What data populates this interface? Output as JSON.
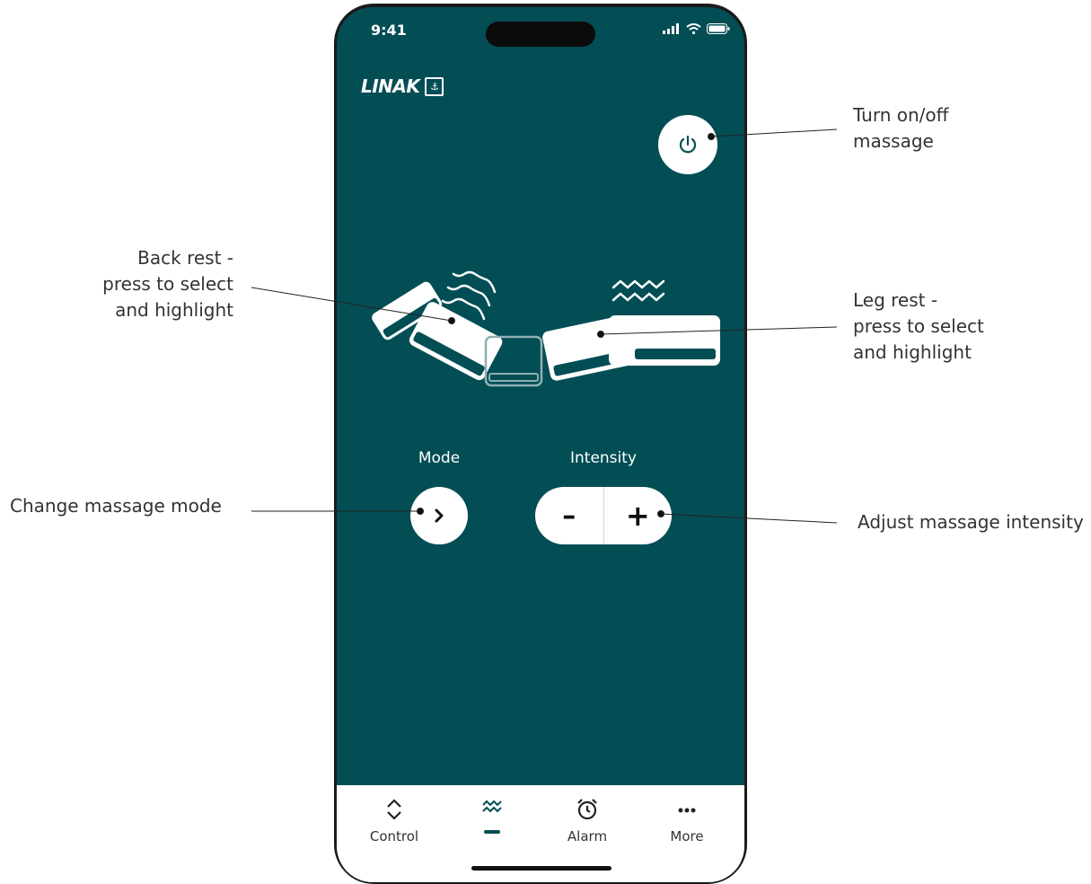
{
  "status_bar": {
    "time": "9:41"
  },
  "brand": {
    "name": "LINAK"
  },
  "controls": {
    "mode_label": "Mode",
    "intensity_label": "Intensity",
    "decrease_symbol": "–",
    "increase_symbol": "+"
  },
  "tabs": [
    {
      "label": "Control",
      "icon": "chevron-updown-icon"
    },
    {
      "label": "",
      "icon": "waves-icon",
      "active": true
    },
    {
      "label": "Alarm",
      "icon": "alarm-clock-icon"
    },
    {
      "label": "More",
      "icon": "ellipsis-icon"
    }
  ],
  "annotations": {
    "power": [
      "Turn on/off",
      "massage"
    ],
    "back_rest": [
      "Back rest -",
      "press to select",
      "and highlight"
    ],
    "leg_rest": [
      "Leg rest -",
      "press to select",
      "and highlight"
    ],
    "mode": "Change massage mode",
    "intensity": "Adjust massage intensity"
  },
  "colors": {
    "accent": "#034e55",
    "background": "#ffffff"
  }
}
